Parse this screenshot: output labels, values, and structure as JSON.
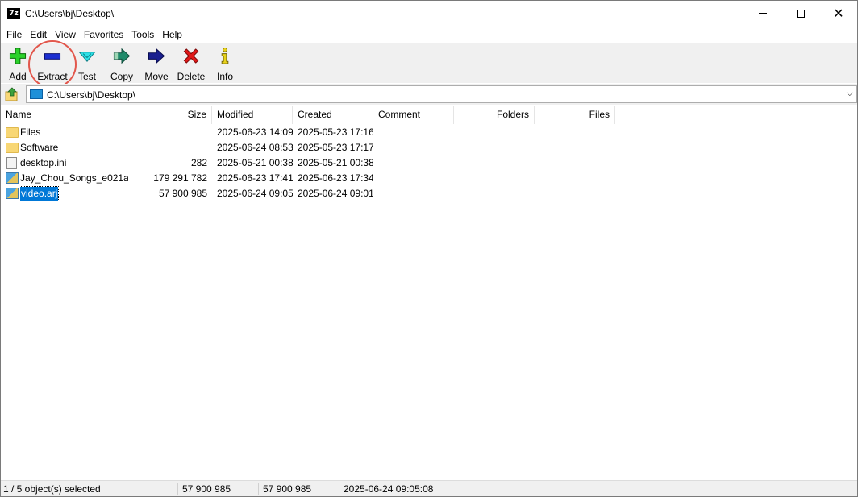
{
  "window": {
    "title": "C:\\Users\\bj\\Desktop\\",
    "app_icon_text": "7z"
  },
  "menu": {
    "items": [
      {
        "label": "File",
        "mnemonic": "F",
        "rest": "ile"
      },
      {
        "label": "Edit",
        "mnemonic": "E",
        "rest": "dit"
      },
      {
        "label": "View",
        "mnemonic": "V",
        "rest": "iew"
      },
      {
        "label": "Favorites",
        "mnemonic": "F",
        "rest": "avorites"
      },
      {
        "label": "Tools",
        "mnemonic": "T",
        "rest": "ools"
      },
      {
        "label": "Help",
        "mnemonic": "H",
        "rest": "elp"
      }
    ]
  },
  "toolbar": {
    "add": "Add",
    "extract": "Extract",
    "test": "Test",
    "copy": "Copy",
    "move": "Move",
    "delete": "Delete",
    "info": "Info",
    "highlighted": "Extract",
    "highlight_color": "#e2574c"
  },
  "address": {
    "path": "C:\\Users\\bj\\Desktop\\"
  },
  "columns": {
    "name": "Name",
    "size": "Size",
    "modified": "Modified",
    "created": "Created",
    "comment": "Comment",
    "folders": "Folders",
    "files": "Files"
  },
  "files": [
    {
      "name": "Files",
      "size": "",
      "modified": "2025-06-23 14:09",
      "created": "2025-05-23 17:16",
      "icon": "folder-icon",
      "selected": false
    },
    {
      "name": "Software",
      "size": "",
      "modified": "2025-06-24 08:53",
      "created": "2025-05-23 17:17",
      "icon": "folder-icon",
      "selected": false
    },
    {
      "name": "desktop.ini",
      "size": "282",
      "modified": "2025-05-21 00:38",
      "created": "2025-05-21 00:38",
      "icon": "ini-file-icon",
      "selected": false
    },
    {
      "name": "Jay_Chou_Songs_e021a...",
      "size": "179 291 782",
      "modified": "2025-06-23 17:41",
      "created": "2025-06-23 17:34",
      "icon": "archive-icon",
      "selected": false
    },
    {
      "name": "video.arj",
      "size": "57 900 985",
      "modified": "2025-06-24 09:05",
      "created": "2025-06-24 09:01",
      "icon": "archive-icon",
      "selected": true
    }
  ],
  "status": {
    "selection": "1 / 5 object(s) selected",
    "size": "57 900 985",
    "packed": "57 900 985",
    "date": "2025-06-24 09:05:08"
  },
  "colors": {
    "selection": "#0078d7",
    "toolbar_bg": "#f0f0f0"
  }
}
